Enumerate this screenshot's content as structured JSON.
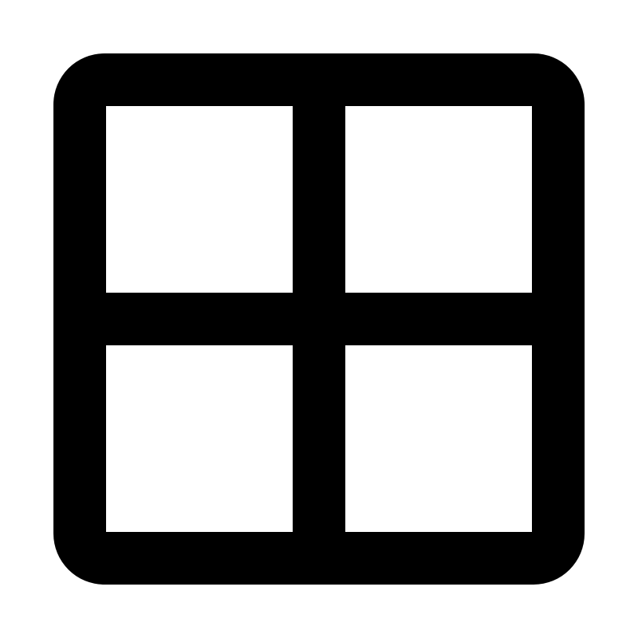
{
  "icon": {
    "name": "grid-icon",
    "foreground_color": "#000000",
    "background_color": "#ffffff",
    "rows": 2,
    "columns": 2
  }
}
